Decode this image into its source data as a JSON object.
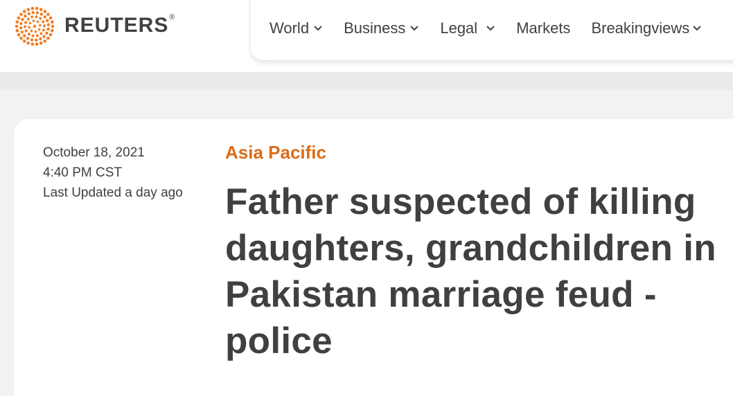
{
  "header": {
    "logo_text": "REUTERS",
    "logo_mark": "®",
    "logo_icon": "reuters-dot-logo-icon",
    "brand_color": "#f47c20"
  },
  "nav": {
    "items": [
      {
        "label": "World",
        "has_dropdown": true
      },
      {
        "label": "Business",
        "has_dropdown": true
      },
      {
        "label": "Legal",
        "has_dropdown": true
      },
      {
        "label": "Markets",
        "has_dropdown": false
      },
      {
        "label": "Breakingviews",
        "has_dropdown": true
      }
    ]
  },
  "article": {
    "date": "October 18, 2021",
    "time": "4:40 PM CST",
    "updated": "Last Updated a day ago",
    "section": "Asia Pacific",
    "section_color": "#dc6b17",
    "headline_lines": [
      "Father suspected of killing",
      "daughters, grandchildren in",
      "Pakistan marriage feud -",
      "police"
    ]
  }
}
